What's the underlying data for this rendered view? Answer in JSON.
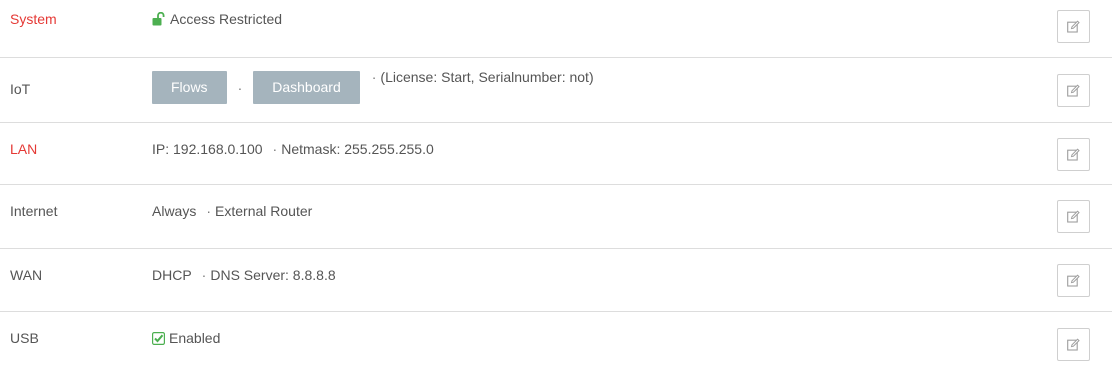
{
  "rows": [
    {
      "label": "System",
      "label_color": "#e53935",
      "icon": "unlock-icon",
      "icon_color": "#4caf50",
      "value": "Access Restricted",
      "edit_icon": "edit-icon"
    },
    {
      "label": "IoT",
      "buttons": [
        "Flows",
        "Dashboard"
      ],
      "separator": "·",
      "value": "(License: Start, Serialnumber: not)",
      "edit_icon": "edit-icon"
    },
    {
      "label": "LAN",
      "label_color": "#e53935",
      "value": "IP: 192.168.0.100",
      "separator": "·",
      "value2": "Netmask: 255.255.255.0",
      "edit_icon": "edit-icon"
    },
    {
      "label": "Internet",
      "value": "Always",
      "separator": "·",
      "value2": "External Router",
      "edit_icon": "edit-icon"
    },
    {
      "label": "WAN",
      "value": "DHCP",
      "separator": "·",
      "value2": "DNS Server: 8.8.8.8",
      "edit_icon": "edit-icon"
    },
    {
      "label": "USB",
      "icon": "checkbox-checked-icon",
      "icon_color": "#4caf50",
      "value": "Enabled",
      "edit_icon": "edit-icon"
    }
  ],
  "colors": {
    "accent_red": "#e53935",
    "ok_green": "#4caf50",
    "button_gray": "#a5b4bd",
    "border": "#dddddd"
  }
}
